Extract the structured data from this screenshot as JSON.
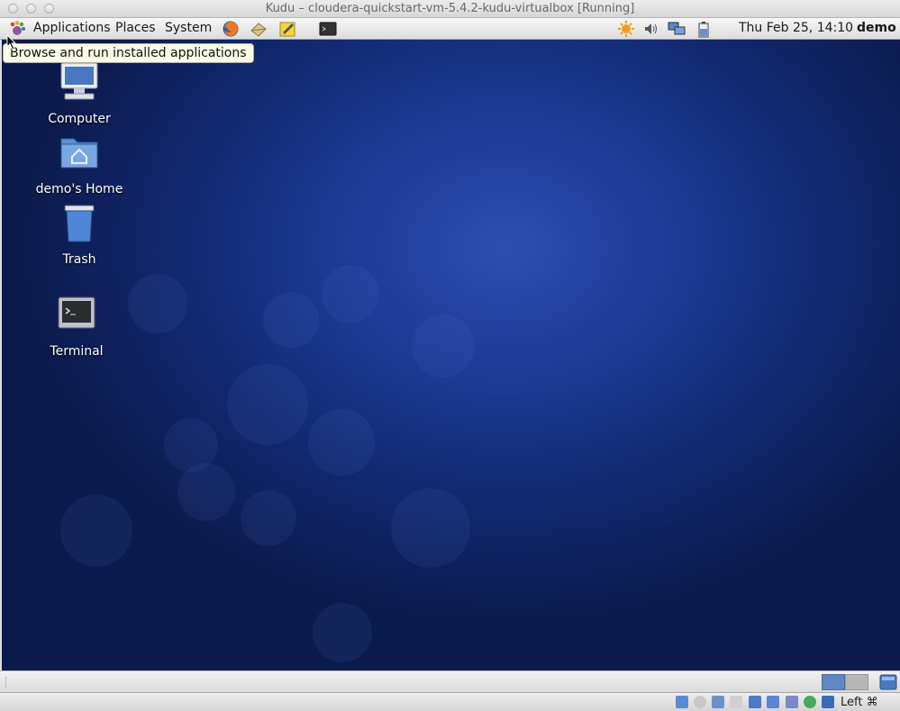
{
  "window": {
    "title": "Kudu – cloudera-quickstart-vm-5.4.2-kudu-virtualbox [Running]"
  },
  "top_panel": {
    "menus": [
      "Applications",
      "Places",
      "System"
    ],
    "launchers": [
      "firefox-icon",
      "mail-icon",
      "text-editor-icon",
      "terminal-icon"
    ],
    "tray": [
      "update-notifier-icon",
      "volume-icon",
      "network-icon",
      "battery-icon"
    ],
    "clock": "Thu Feb 25, 14:10",
    "user": "demo"
  },
  "tooltip": "Browse and run installed applications",
  "desktop_icons": [
    "Computer",
    "demo's Home",
    "Trash",
    "Terminal"
  ],
  "status_bar": {
    "host_key": "Left ⌘"
  }
}
